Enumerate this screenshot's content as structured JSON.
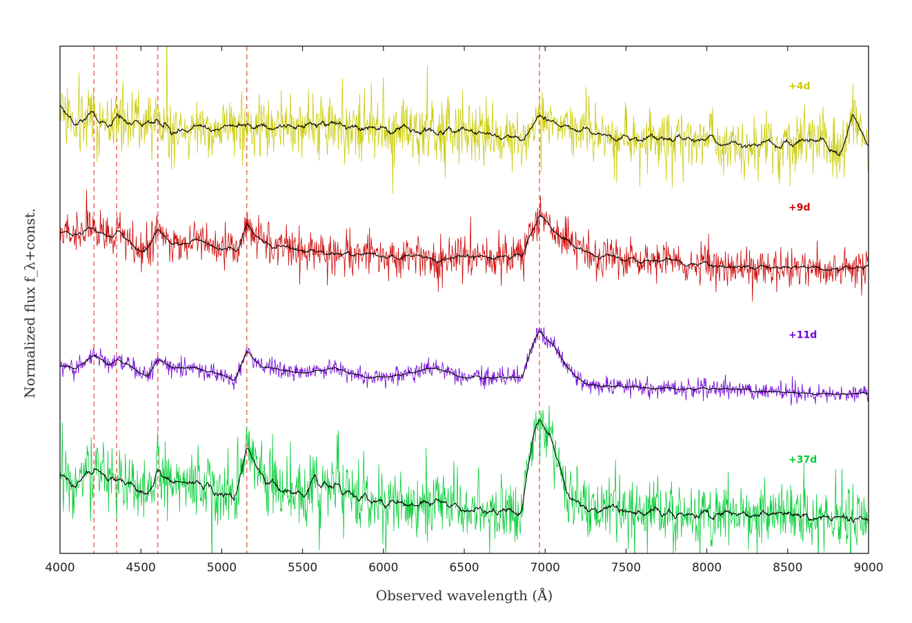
{
  "chart_data": {
    "type": "line",
    "xlabel": "Observed wavelength (Å)",
    "ylabel": "Normalized flux f_λ+const.",
    "xlim": [
      4000,
      9000
    ],
    "ylim": [
      0,
      4.1
    ],
    "x_ticks": [
      4000,
      4500,
      5000,
      5500,
      6000,
      6500,
      7000,
      7500,
      8000,
      8500,
      9000
    ],
    "y_ticks_shown": false,
    "grid": false,
    "legend": "labels at right",
    "reference_lines": {
      "style": "dashed",
      "color": "#e8413a",
      "x": [
        4210,
        4350,
        4605,
        5155,
        6965
      ]
    },
    "series": [
      {
        "name": "+4d",
        "color": "#c9c900",
        "noise": 0.24,
        "smooth_color": "#000000",
        "x": [
          4000,
          4100,
          4210,
          4300,
          4350,
          4450,
          4605,
          4700,
          4850,
          5000,
          5155,
          5300,
          5500,
          5700,
          5900,
          6100,
          6300,
          6500,
          6700,
          6860,
          6965,
          7100,
          7300,
          7500,
          7700,
          7900,
          8100,
          8300,
          8500,
          8700,
          8820,
          8900,
          9000
        ],
        "y": [
          3.62,
          3.45,
          3.58,
          3.43,
          3.55,
          3.46,
          3.5,
          3.4,
          3.46,
          3.44,
          3.48,
          3.43,
          3.46,
          3.5,
          3.42,
          3.44,
          3.4,
          3.43,
          3.38,
          3.35,
          3.56,
          3.45,
          3.4,
          3.36,
          3.37,
          3.35,
          3.33,
          3.32,
          3.32,
          3.33,
          3.2,
          3.55,
          3.3
        ]
      },
      {
        "name": "+9d",
        "color": "#cc0000",
        "noise": 0.15,
        "smooth_color": "#000000",
        "x": [
          4000,
          4100,
          4210,
          4300,
          4350,
          4450,
          4520,
          4605,
          4700,
          4850,
          5000,
          5100,
          5155,
          5250,
          5400,
          5600,
          5800,
          6000,
          6200,
          6400,
          6600,
          6860,
          6965,
          7050,
          7200,
          7400,
          7600,
          7800,
          8000,
          8200,
          8400,
          8600,
          8800,
          9000
        ],
        "y": [
          2.6,
          2.57,
          2.62,
          2.55,
          2.6,
          2.5,
          2.42,
          2.62,
          2.5,
          2.53,
          2.45,
          2.45,
          2.68,
          2.5,
          2.47,
          2.44,
          2.42,
          2.4,
          2.4,
          2.38,
          2.4,
          2.4,
          2.74,
          2.62,
          2.45,
          2.4,
          2.36,
          2.37,
          2.33,
          2.32,
          2.32,
          2.32,
          2.3,
          2.32
        ]
      },
      {
        "name": "+11d",
        "color": "#7000d8",
        "noise": 0.07,
        "smooth_color": "#000000",
        "x": [
          4000,
          4100,
          4210,
          4300,
          4350,
          4450,
          4540,
          4605,
          4700,
          4850,
          5000,
          5080,
          5155,
          5250,
          5400,
          5500,
          5700,
          5900,
          6100,
          6300,
          6500,
          6700,
          6860,
          6920,
          6965,
          7050,
          7150,
          7250,
          7400,
          7600,
          7800,
          8000,
          8200,
          8400,
          8600,
          8800,
          9000
        ],
        "y": [
          1.52,
          1.5,
          1.6,
          1.52,
          1.57,
          1.5,
          1.42,
          1.57,
          1.5,
          1.5,
          1.45,
          1.4,
          1.64,
          1.5,
          1.48,
          1.45,
          1.5,
          1.42,
          1.44,
          1.5,
          1.42,
          1.42,
          1.42,
          1.68,
          1.8,
          1.68,
          1.48,
          1.37,
          1.35,
          1.34,
          1.33,
          1.33,
          1.33,
          1.3,
          1.3,
          1.29,
          1.29
        ]
      },
      {
        "name": "+37d",
        "color": "#00cc33",
        "noise": 0.26,
        "smooth_color": "#000000",
        "x": [
          4000,
          4100,
          4210,
          4300,
          4350,
          4450,
          4540,
          4605,
          4700,
          4850,
          5000,
          5080,
          5155,
          5250,
          5400,
          5500,
          5580,
          5700,
          5900,
          6100,
          6300,
          6500,
          6700,
          6860,
          6930,
          6965,
          7050,
          7150,
          7250,
          7400,
          7600,
          7800,
          8000,
          8200,
          8400,
          8600,
          8800,
          9000
        ],
        "y": [
          0.62,
          0.55,
          0.68,
          0.58,
          0.62,
          0.55,
          0.45,
          0.65,
          0.58,
          0.58,
          0.48,
          0.42,
          0.85,
          0.6,
          0.5,
          0.48,
          0.65,
          0.5,
          0.45,
          0.4,
          0.42,
          0.35,
          0.35,
          0.35,
          1.0,
          1.12,
          0.88,
          0.45,
          0.35,
          0.35,
          0.33,
          0.32,
          0.32,
          0.32,
          0.32,
          0.3,
          0.3,
          0.28
        ]
      }
    ]
  }
}
